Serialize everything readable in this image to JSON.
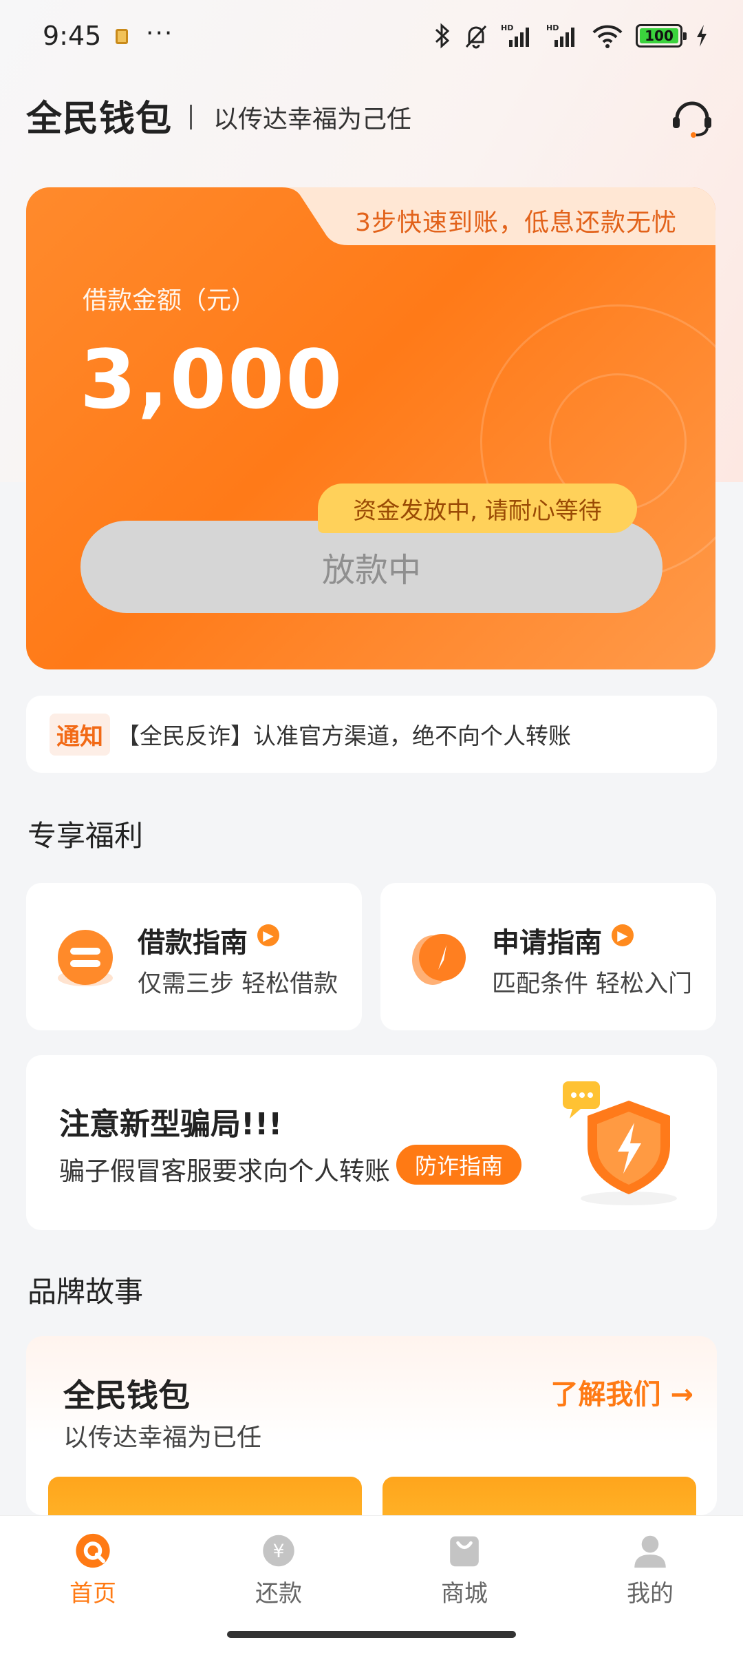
{
  "status_bar": {
    "time": "9:45",
    "more": "···",
    "icons": [
      "bluetooth-icon",
      "bell-muted-icon",
      "signal-hd-icon",
      "signal-hd-icon",
      "wifi-icon",
      "battery-icon",
      "charging-icon"
    ],
    "battery": "100"
  },
  "header": {
    "app_name": "全民钱包",
    "slogan": "以传达幸福为己任",
    "service_icon": "headset-icon"
  },
  "loan_card": {
    "tagline": "3步快速到账，低息还款无忧",
    "amount_label": "借款金额（元）",
    "amount": "3,000",
    "tip": "资金发放中, 请耐心等待",
    "button": "放款中",
    "colors": {
      "accent": "#ff7a18",
      "button_disabled": "#d6d6d6",
      "tip_bg": "#ffd15a"
    }
  },
  "notice": {
    "tag": "通知",
    "text": "【全民反诈】认准官方渠道，绝不向个人转账"
  },
  "benefits": {
    "title": "专享福利",
    "items": [
      {
        "title": "借款指南",
        "subtitle": "仅需三步 轻松借款",
        "icon": "loan-guide-icon"
      },
      {
        "title": "申请指南",
        "subtitle": "匹配条件 轻松入门",
        "icon": "compass-icon"
      }
    ]
  },
  "fraud": {
    "title": "注意新型骗局!!!",
    "subtitle": "骗子假冒客服要求向个人转账",
    "button": "防诈指南",
    "icon": "shield-icon"
  },
  "brand_story": {
    "section_title": "品牌故事",
    "title": "全民钱包",
    "subtitle": "以传达幸福为已任",
    "link": "了解我们 →"
  },
  "tabbar": {
    "items": [
      {
        "label": "首页",
        "icon": "home-icon",
        "active": true
      },
      {
        "label": "还款",
        "icon": "yuan-coin-icon",
        "active": false
      },
      {
        "label": "商城",
        "icon": "shopping-bag-icon",
        "active": false
      },
      {
        "label": "我的",
        "icon": "profile-icon",
        "active": false
      }
    ]
  }
}
